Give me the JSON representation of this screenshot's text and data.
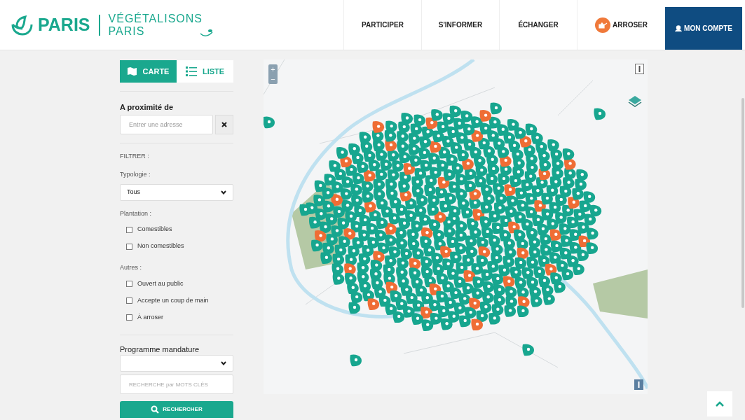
{
  "header": {
    "logo_text": "PARIS",
    "brand_lines": [
      "VÉGÉTALISONS",
      "PARIS"
    ],
    "nav": [
      {
        "label": "PARTICIPER",
        "kind": "plain"
      },
      {
        "label": "S'INFORMER",
        "kind": "plain"
      },
      {
        "label": "ÉCHANGER",
        "kind": "plain"
      },
      {
        "label": "ARROSER",
        "kind": "watering"
      },
      {
        "label": "MON COMPTE",
        "kind": "account"
      }
    ]
  },
  "sidebar": {
    "view_toggle": [
      {
        "label": "CARTE",
        "selected": true
      },
      {
        "label": "LISTE",
        "selected": false
      }
    ],
    "proximity": {
      "label": "A proximité de",
      "placeholder": "Entrer une adresse"
    },
    "filter_heading": "FILTRER :",
    "typology": {
      "label": "Typologie :",
      "value": "Tous"
    },
    "groups": [
      {
        "label": "Plantation :",
        "options": [
          {
            "label": "Comestibles",
            "checked": false
          },
          {
            "label": "Non comestibles",
            "checked": false
          }
        ]
      },
      {
        "label": "Autres :",
        "options": [
          {
            "label": "Ouvert au public",
            "checked": false
          },
          {
            "label": "Accepte un coup de main",
            "checked": false
          },
          {
            "label": "À arroser",
            "checked": false
          }
        ]
      }
    ],
    "programme": {
      "label": "Programme mandature"
    },
    "keywords": {
      "placeholder": "RECHERCHE par MOTS CLÉS"
    },
    "search_button": "RECHERCHER"
  },
  "map": {
    "zoom_in": "+",
    "zoom_out": "−"
  }
}
